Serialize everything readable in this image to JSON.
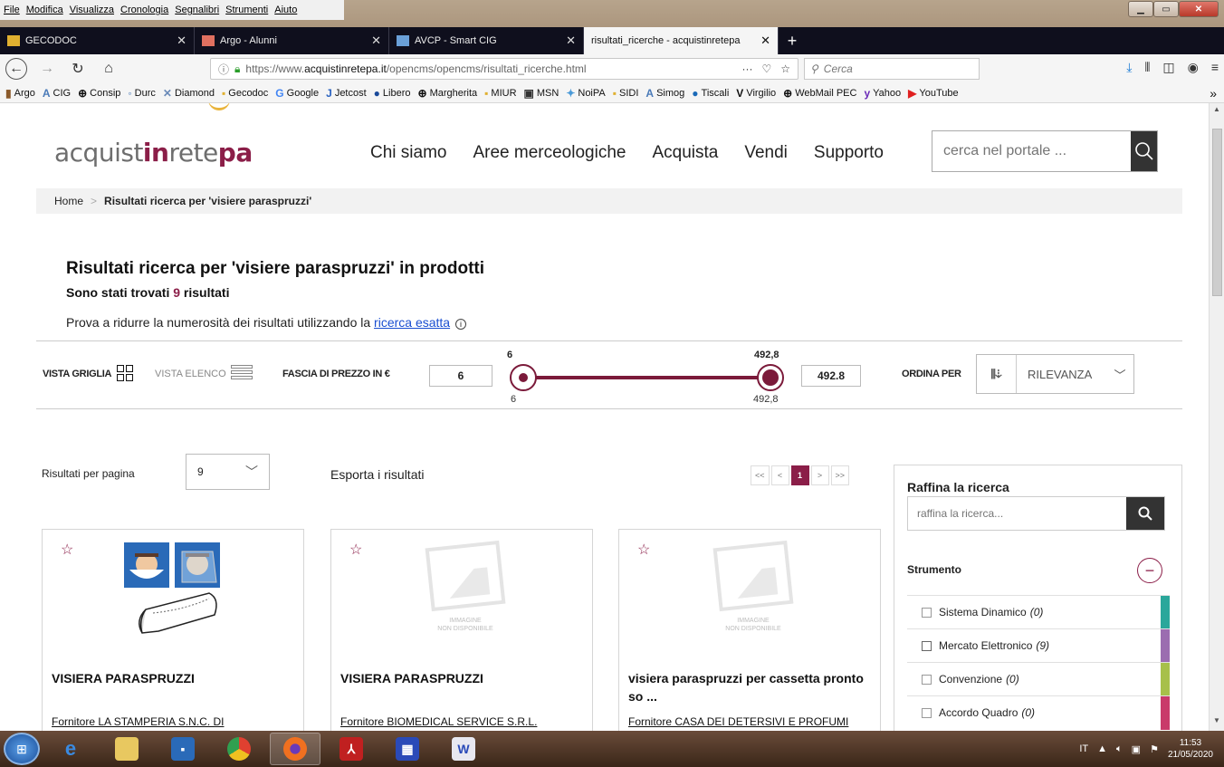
{
  "menubar": [
    "File",
    "Modifica",
    "Visualizza",
    "Cronologia",
    "Segnalibri",
    "Strumenti",
    "Aiuto"
  ],
  "tabs": [
    {
      "title": "GECODOC",
      "active": false,
      "color": "#e0b030"
    },
    {
      "title": "Argo - Alunni",
      "active": false,
      "color": "#e07060"
    },
    {
      "title": "AVCP - Smart CIG",
      "active": false,
      "color": "#6aa0d8"
    },
    {
      "title": "risultati_ricerche - acquistinretepa",
      "active": true,
      "color": "#8b1e48"
    }
  ],
  "url": {
    "prefix": "https://www.",
    "domain": "acquistinretepa.it",
    "path": "/opencms/opencms/risultati_ricerche.html"
  },
  "browser_search_placeholder": "Cerca",
  "bookmarks": [
    "Argo",
    "CIG",
    "Consip",
    "Durc",
    "Diamond",
    "Gecodoc",
    "Google",
    "Jetcost",
    "Libero",
    "Margherita",
    "MIUR",
    "MSN",
    "NoiPA",
    "SIDI",
    "Simog",
    "Tiscali",
    "Virgilio",
    "WebMail PEC",
    "Yahoo",
    "YouTube"
  ],
  "site": {
    "logo": {
      "p1": "acquist",
      "p2": "in",
      "p3": "rete",
      "p4": "pa"
    },
    "nav": [
      "Chi siamo",
      "Aree merceologiche",
      "Acquista",
      "Vendi",
      "Supporto"
    ],
    "search_placeholder": "cerca nel portale ..."
  },
  "breadcrumb": {
    "home": "Home",
    "sep": ">",
    "current": "Risultati ricerca per 'visiere paraspruzzi'"
  },
  "results": {
    "title": "Risultati ricerca per 'visiere paraspruzzi' in prodotti",
    "count_prefix": "Sono stati trovati ",
    "count": "9",
    "count_suffix": " risultati",
    "hint_text": "Prova a ridurre la numerosità dei risultati utilizzando la ",
    "hint_link": "ricerca esatta",
    "hint_icon": "info-icon"
  },
  "filters": {
    "view_grid": "VISTA GRIGLIA",
    "view_list": "VISTA ELENCO",
    "price_label": "FASCIA DI PREZZO IN €",
    "price_min": "6",
    "price_max": "492.8",
    "slider_min_label": "6",
    "slider_max_label": "492,8",
    "sort_label": "ORDINA PER",
    "sort_value": "RILEVANZA"
  },
  "listing": {
    "per_page_label": "Risultati per pagina",
    "per_page_value": "9",
    "export_label": "Esporta i risultati",
    "pager": [
      "<<",
      "<",
      "1",
      ">",
      ">>"
    ],
    "current_page": "1"
  },
  "products": [
    {
      "name": "VISIERA PARASPRUZZI",
      "supplier": "Fornitore LA STAMPERIA S.N.C. DI",
      "has_image": true
    },
    {
      "name": "VISIERA PARASPRUZZI",
      "supplier": "Fornitore BIOMEDICAL SERVICE S.R.L.",
      "has_image": false,
      "noimg_label_1": "IMMAGINE",
      "noimg_label_2": "NON DISPONIBILE"
    },
    {
      "name": "visiera paraspruzzi per cassetta pronto so ...",
      "supplier": "Fornitore CASA DEI DETERSIVI E PROFUMI",
      "has_image": false,
      "noimg_label_1": "IMMAGINE",
      "noimg_label_2": "NON DISPONIBILE"
    }
  ],
  "refine": {
    "title": "Raffina la ricerca",
    "placeholder": "raffina la ricerca...",
    "group": "Strumento",
    "options": [
      {
        "label": "Sistema Dinamico",
        "count": "(0)",
        "checked": false,
        "color": "#2aa79b"
      },
      {
        "label": "Mercato Elettronico",
        "count": "(9)",
        "checked": false,
        "color": "#9b6db0"
      },
      {
        "label": "Convenzione",
        "count": "(0)",
        "checked": false,
        "color": "#a7c04a"
      },
      {
        "label": "Accordo Quadro",
        "count": "(0)",
        "checked": false,
        "color": "#c93a6a"
      }
    ]
  },
  "tray": {
    "lang": "IT",
    "time": "11:53",
    "date": "21/05/2020"
  },
  "colors": {
    "brand": "#8b1e48",
    "slider": "#7b1a3a",
    "link": "#1a4fd1"
  }
}
